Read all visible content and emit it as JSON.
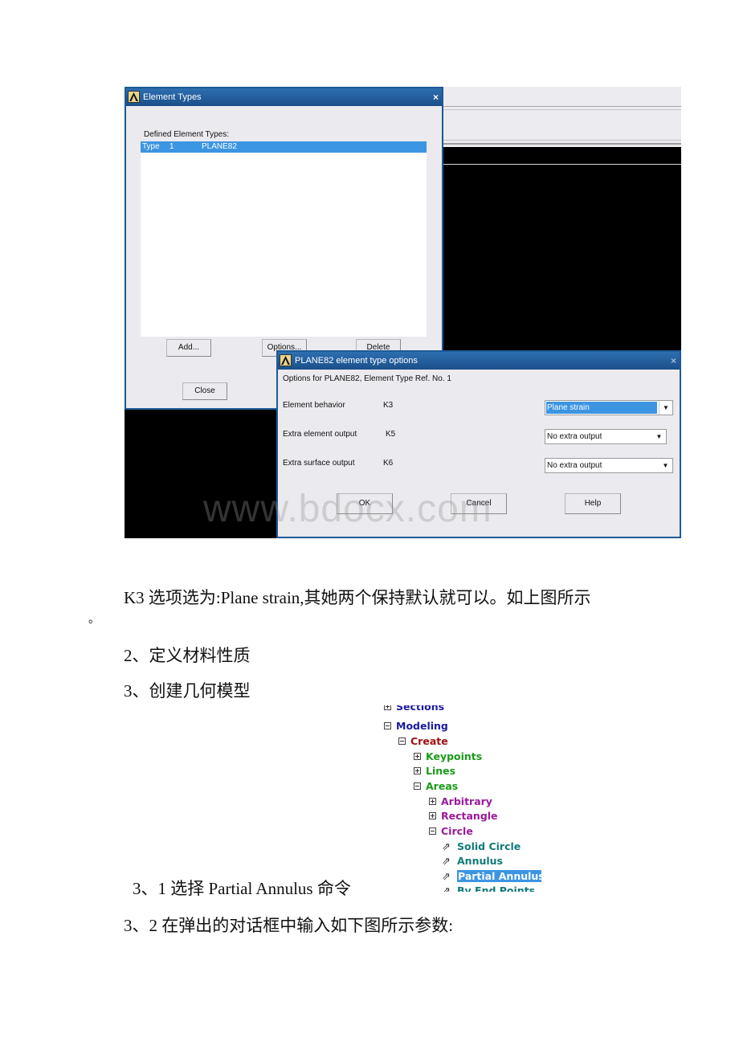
{
  "screenshot1": {
    "element_types_dialog": {
      "title": "Element Types",
      "close_glyph": "×",
      "defined_label": "Defined Element Types:",
      "list_rows": [
        {
          "type_label": "Type",
          "number": "1",
          "element": "PLANE82",
          "selected": true
        }
      ],
      "buttons": {
        "add": "Add...",
        "options": "Options...",
        "delete": "Delete",
        "close": "Close"
      }
    },
    "options_dialog": {
      "title": "PLANE82 element type options",
      "close_glyph": "×",
      "subtitle": "Options for PLANE82, Element Type Ref. No. 1",
      "options": [
        {
          "label": "Element behavior",
          "key": "K3",
          "value": "Plane strain",
          "active": true
        },
        {
          "label": "Extra element output",
          "key": "K5",
          "value": "No extra output",
          "active": false
        },
        {
          "label": "Extra surface output",
          "key": "K6",
          "value": "No extra output",
          "active": false
        }
      ],
      "buttons": {
        "ok": "OK",
        "cancel": "Cancel",
        "help": "Help"
      }
    },
    "watermark": "www.bdocx.com"
  },
  "text": {
    "para1": "K3 选项选为:Plane strain,其她两个保持默认就可以。如上图所示",
    "para1_tail": "。",
    "step2": "2、定义材料性质",
    "step3": "3、创建几何模型",
    "step3_1": "3、1 选择 Partial Annulus 命令",
    "step3_2": "3、2 在弹出的对话框中输入如下图所示参数:"
  },
  "tree": {
    "items": [
      {
        "label": "Sections",
        "expander": "plus",
        "color": "#1a1aa0"
      },
      {
        "label": "Modeling",
        "expander": "minus",
        "color": "#1a1aa0"
      },
      {
        "label": "Create",
        "expander": "minus",
        "color": "#a01010"
      },
      {
        "label": "Keypoints",
        "expander": "plus",
        "color": "#1a9a1a"
      },
      {
        "label": "Lines",
        "expander": "plus",
        "color": "#1a9a1a"
      },
      {
        "label": "Areas",
        "expander": "minus",
        "color": "#1a9a1a"
      },
      {
        "label": "Arbitrary",
        "expander": "plus",
        "color": "#9a1a9a"
      },
      {
        "label": "Rectangle",
        "expander": "plus",
        "color": "#9a1a9a"
      },
      {
        "label": "Circle",
        "expander": "minus",
        "color": "#9a1a9a"
      },
      {
        "label": "Solid Circle",
        "expander": "command",
        "color": "#127a7a"
      },
      {
        "label": "Annulus",
        "expander": "command",
        "color": "#127a7a"
      },
      {
        "label": "Partial Annulus",
        "expander": "command",
        "color": "#127a7a",
        "selected": true
      },
      {
        "label": "By End Points",
        "expander": "command",
        "color": "#127a7a"
      }
    ],
    "command_glyph": "⇗"
  }
}
